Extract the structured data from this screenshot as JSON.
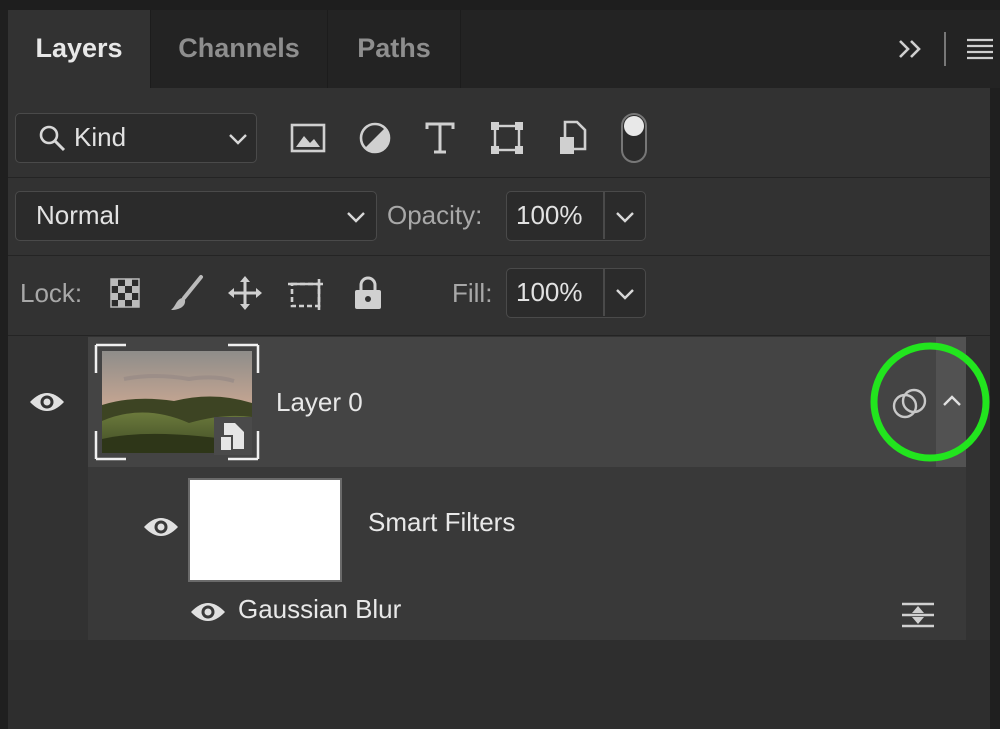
{
  "tabs": [
    {
      "label": "Layers",
      "active": true
    },
    {
      "label": "Channels",
      "active": false
    },
    {
      "label": "Paths",
      "active": false
    }
  ],
  "filter": {
    "kind_label": "Kind",
    "icons": [
      "image-filter-icon",
      "adjustment-filter-icon",
      "type-filter-icon",
      "shape-filter-icon",
      "smart-object-filter-icon",
      "filter-toggle-switch"
    ]
  },
  "blend": {
    "mode": "Normal",
    "opacity_label": "Opacity:",
    "opacity_value": "100%"
  },
  "lock": {
    "label": "Lock:",
    "fill_label": "Fill:",
    "fill_value": "100%"
  },
  "layers": [
    {
      "name": "Layer 0",
      "type": "smart-object",
      "visible": true
    }
  ],
  "smart_filters": {
    "label": "Smart Filters",
    "items": [
      {
        "name": "Gaussian Blur",
        "visible": true
      }
    ]
  },
  "colors": {
    "highlight_circle": "#22e51e",
    "panel_bg": "#323232",
    "selected_row": "#444444"
  }
}
